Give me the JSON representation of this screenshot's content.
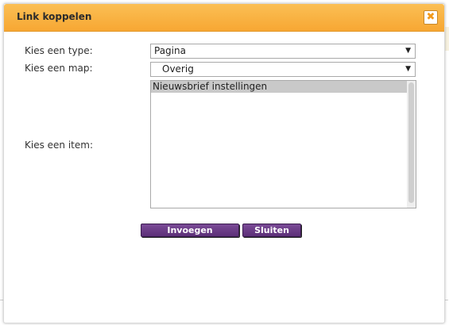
{
  "dialog": {
    "title": "Link koppelen",
    "close_icon": "close-icon",
    "accent_color": "#f7a733",
    "button_color": "#6a3a86"
  },
  "form": {
    "type_label": "Kies een type:",
    "type_value": "Pagina",
    "map_label": "Kies een map:",
    "map_value": "Overig",
    "item_label": "Kies een item:",
    "items": [
      {
        "label": "Nieuwsbrief instellingen",
        "selected": true
      }
    ]
  },
  "buttons": {
    "insert_label": "Invoegen",
    "close_label": "Sluiten"
  }
}
